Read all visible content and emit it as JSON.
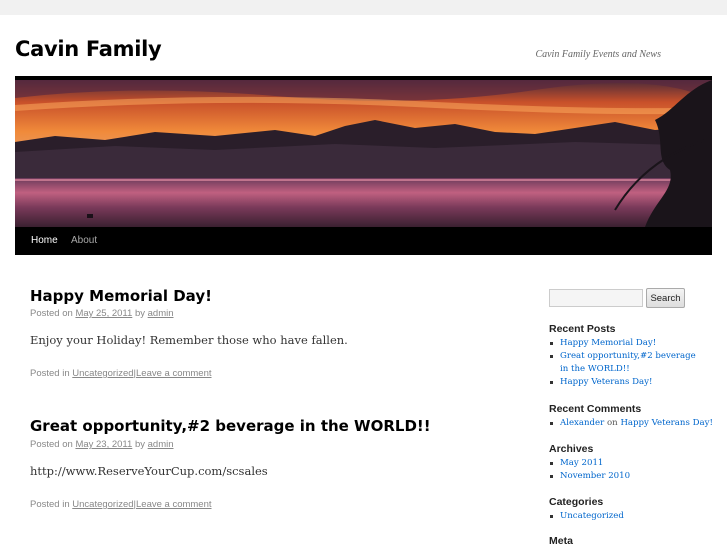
{
  "site": {
    "title": "Cavin Family",
    "description": "Cavin Family Events and News"
  },
  "nav": {
    "items": [
      {
        "label": "Home",
        "current": true
      },
      {
        "label": "About",
        "current": false
      }
    ]
  },
  "posts": [
    {
      "title": "Happy Memorial Day!",
      "posted_on": "Posted on",
      "date": "May 25, 2011",
      "by": "by",
      "author": "admin",
      "content": "Enjoy your Holiday! Remember those who have fallen.",
      "posted_in": "Posted in",
      "category": "Uncategorized",
      "sep": "|",
      "comment_link": "Leave a comment"
    },
    {
      "title": "Great opportunity,#2 beverage in the WORLD!!",
      "posted_on": "Posted on",
      "date": "May 23, 2011",
      "by": "by",
      "author": "admin",
      "content": "http://www.ReserveYourCup.com/scsales",
      "posted_in": "Posted in",
      "category": "Uncategorized",
      "sep": "|",
      "comment_link": "Leave a comment"
    }
  ],
  "sidebar": {
    "search_button": "Search",
    "search_value": "",
    "recent_posts": {
      "title": "Recent Posts",
      "items": [
        "Happy Memorial Day!",
        "Great opportunity,#2 beverage in the WORLD!!",
        "Happy Veterans Day!"
      ]
    },
    "recent_comments": {
      "title": "Recent Comments",
      "author": "Alexander",
      "on": "on",
      "post": "Happy Veterans Day!"
    },
    "archives": {
      "title": "Archives",
      "items": [
        "May 2011",
        "November 2010"
      ]
    },
    "categories": {
      "title": "Categories",
      "items": [
        "Uncategorized"
      ]
    },
    "meta": {
      "title": "Meta"
    }
  },
  "colors": {
    "link": "#0066cc",
    "nav_bg": "#000000",
    "page_bg": "#f1f1f1"
  }
}
